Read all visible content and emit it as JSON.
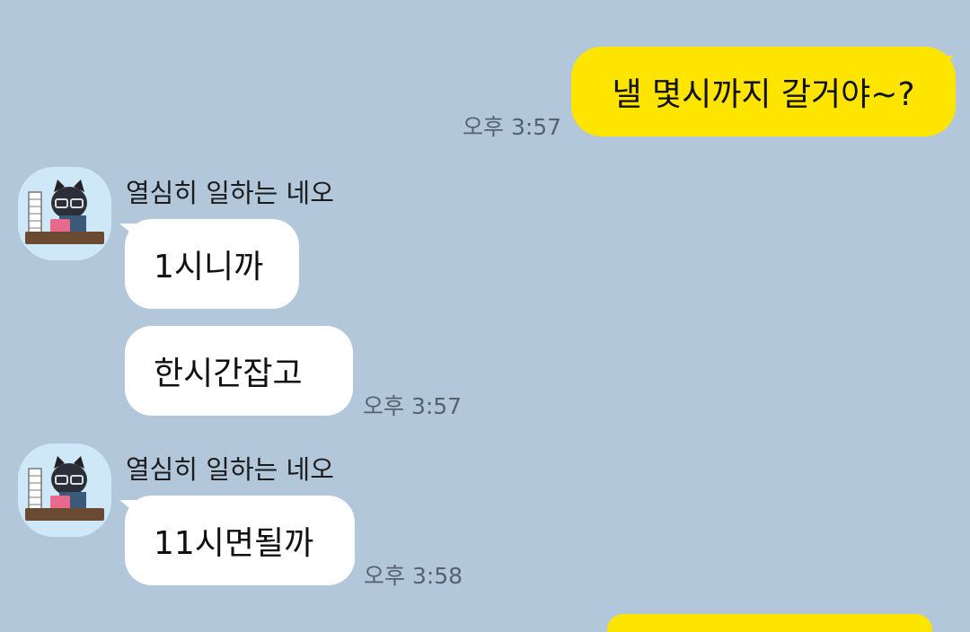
{
  "colors": {
    "chat_background": "#b2c7da",
    "my_bubble": "#fee500",
    "their_bubble": "#ffffff",
    "timestamp": "#556270"
  },
  "messages": {
    "m1": {
      "text": "낼 몇시까지 갈거야~?",
      "time": "오후 3:57"
    },
    "m2": {
      "sender": "열심히 일하는 네오",
      "avatar_icon": "neo-working-avatar-icon",
      "text": "1시니까"
    },
    "m3": {
      "text": "한시간잡고",
      "time": "오후 3:57"
    },
    "m4": {
      "sender": "열심히 일하는 네오",
      "avatar_icon": "neo-working-avatar-icon",
      "text": "11시면될까",
      "time": "오후 3:58"
    }
  }
}
